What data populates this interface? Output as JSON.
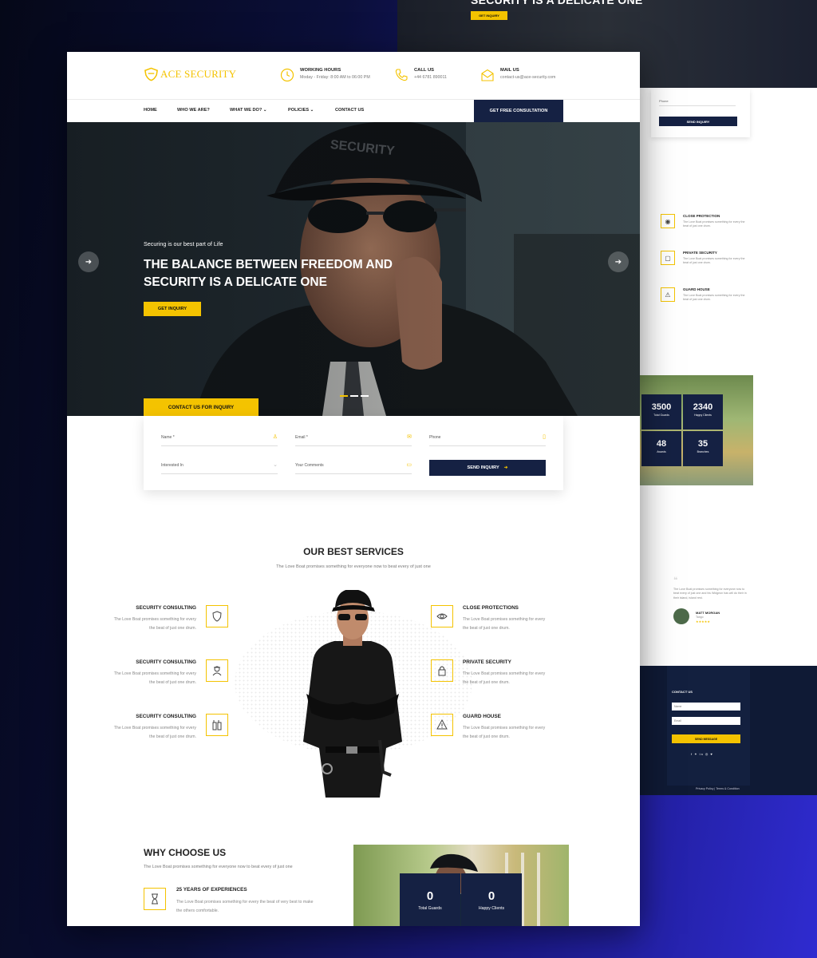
{
  "preview": {
    "hero_title": "SECURITY IS A DELICATE ONE",
    "hero_button": "GET INQUIRY",
    "form_phone": "Phone",
    "form_send": "SEND INQUIRY",
    "services": [
      {
        "title": "CLOSE PROTECTION",
        "desc": "The Love Boat promises something for every the beat of just one drum.",
        "icon": "eye-icon"
      },
      {
        "title": "PRIVATE SECURITY",
        "desc": "The Love Boat promises something for every the beat of just one drum.",
        "icon": "lock-icon"
      },
      {
        "title": "GUARD HOUSE",
        "desc": "The Love Boat promises something for every the beat of just one drum.",
        "icon": "warning-icon"
      }
    ],
    "stats": [
      {
        "value": "3500",
        "label": "Total Guards"
      },
      {
        "value": "2340",
        "label": "Happy Clients"
      },
      {
        "value": "48",
        "label": "Awards"
      },
      {
        "value": "35",
        "label": "Branches"
      }
    ],
    "testimonial": {
      "text": "The Love Boat promises something for everyone now to beat every of just one and his Widgeon has will do their in their island, island rest.",
      "name": "MATT MORGAN",
      "role": "Tango",
      "rating": 5
    },
    "footer": {
      "contact_title": "CONTACT US",
      "name_placeholder": "Name",
      "email_placeholder": "Email",
      "send_label": "SEND MESSAGE",
      "links": "Privacy Policy  |  Terms & Condition"
    }
  },
  "header": {
    "logo": "ACE SECURITY",
    "working": {
      "title": "WORKING HOURS",
      "value": "Moday - Friday: 8:00 AM to 06:00 PM"
    },
    "call": {
      "title": "CALL US",
      "value": "+44 6781 890011"
    },
    "mail": {
      "title": "MAIL US",
      "value": "contact-us@ace-security.com"
    }
  },
  "nav": {
    "items": [
      "HOME",
      "WHO WE ARE?",
      "WHAT WE DO? ⌄",
      "POLICIES ⌄",
      "CONTACT US"
    ],
    "cta": "GET FREE CONSULTATION"
  },
  "hero": {
    "subtitle": "Securing is our best part of Life",
    "title_line1": "THE BALANCE BETWEEN FREEDOM AND",
    "title_line2": "SECURITY IS A DELICATE ONE",
    "button": "GET INQUIRY",
    "contact_tab": "CONTACT US FOR INQUIRY"
  },
  "inquiry": {
    "name": "Name *",
    "email": "Email *",
    "phone": "Phone",
    "interested": "Interested In",
    "comments": "Your Comments",
    "send": "SEND INQUIRY"
  },
  "services": {
    "title": "OUR BEST SERVICES",
    "subtitle": "The Love Boat promises something for everyone now to beat every of just one",
    "left": [
      {
        "title": "SECURITY CONSULTING",
        "desc": "The Love Boat promises something for every the beat of just one drum.",
        "icon": "shield-icon"
      },
      {
        "title": "SECURITY CONSULTING",
        "desc": "The Love Boat promises something for every the beat of just one drum.",
        "icon": "guard-icon"
      },
      {
        "title": "SECURITY CONSULTING",
        "desc": "The Love Boat promises something for every the beat of just one drum.",
        "icon": "walkie-talkie-icon"
      }
    ],
    "right": [
      {
        "title": "CLOSE PROTECTIONS",
        "desc": "The Love Boat promises something for every the beat of just one drum.",
        "icon": "eye-icon"
      },
      {
        "title": "PRIVATE SECURITY",
        "desc": "The Love Boat promises something for every the beat of just one drum.",
        "icon": "lock-icon"
      },
      {
        "title": "GUARD HOUSE",
        "desc": "The Love Boat promises something for every the beat of just one drum.",
        "icon": "warning-icon"
      }
    ]
  },
  "why": {
    "title": "WHY CHOOSE US",
    "subtitle": "The Love Boat promises something for everyone now to beat every of just one",
    "item_title": "25 YEARS OF EXPERIENCES",
    "item_desc": "The Love Boat promises something for every the beat of very best to make the others comfortable.",
    "item_icon": "hourglass-icon",
    "counters": [
      {
        "value": "0",
        "label": "Total Guards"
      },
      {
        "value": "0",
        "label": "Happy Clients"
      }
    ]
  },
  "colors": {
    "accent": "#f4c300",
    "navy": "#152143",
    "text": "#222222"
  }
}
